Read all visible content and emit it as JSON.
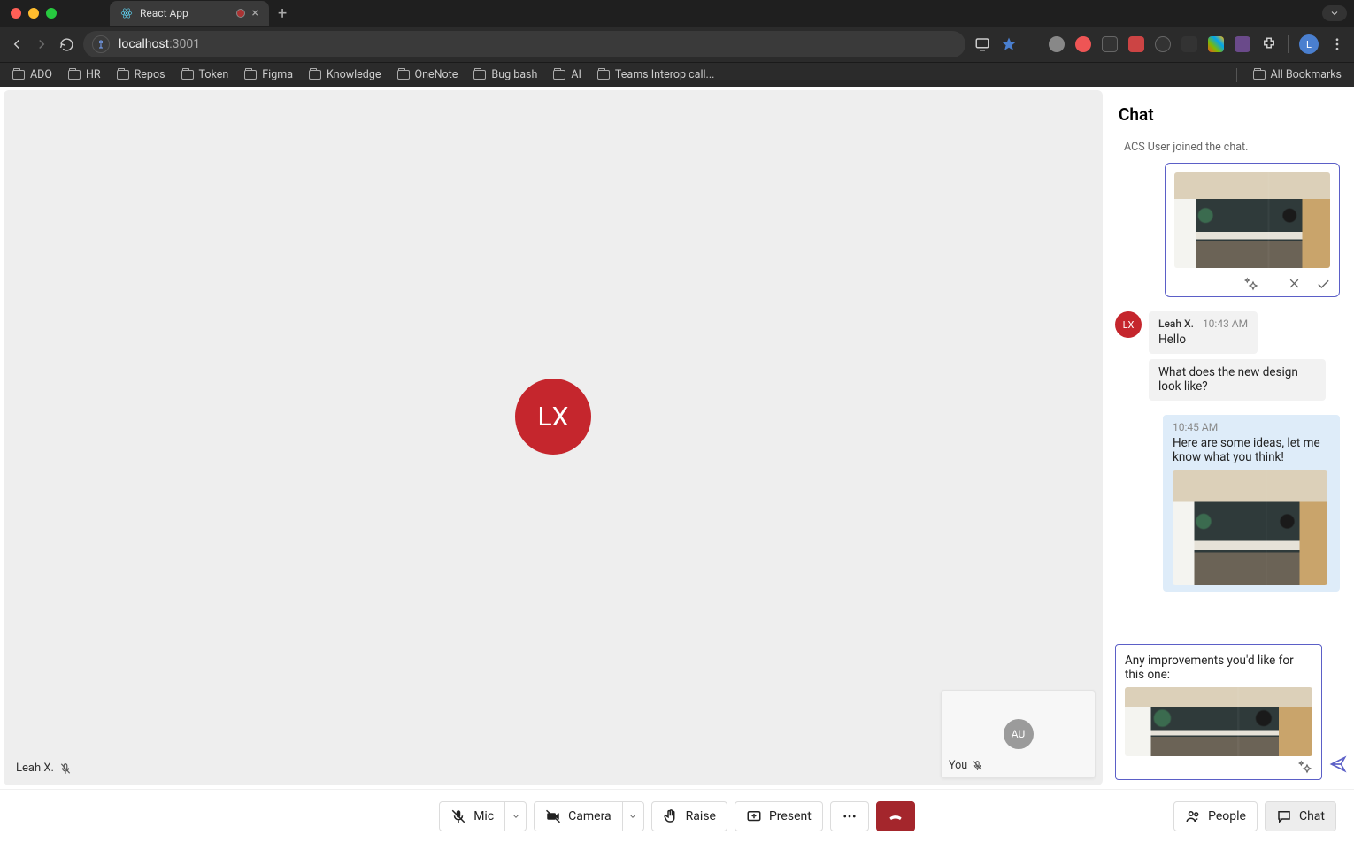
{
  "browser": {
    "tab_title": "React App",
    "url_host": "localhost",
    "url_path": ":3001",
    "bookmarks": [
      "ADO",
      "HR",
      "Repos",
      "Token",
      "Figma",
      "Knowledge",
      "OneNote",
      "Bug bash",
      "AI",
      "Teams Interop call..."
    ],
    "all_bookmarks": "All Bookmarks",
    "profile_initial": "L"
  },
  "call": {
    "main_initials": "LX",
    "main_name": "Leah X.",
    "self_initials": "AU",
    "self_label": "You"
  },
  "chat": {
    "title": "Chat",
    "system": "ACS User joined the chat.",
    "m1_author": "Leah X.",
    "m1_time": "10:43 AM",
    "m1_body": "Hello",
    "m2_body": "What does the new design look like?",
    "m3_time": "10:45 AM",
    "m3_body": "Here are some ideas, let me know what you think!",
    "compose_text": "Any improvements you'd like for this one:"
  },
  "controls": {
    "mic": "Mic",
    "camera": "Camera",
    "raise": "Raise",
    "present": "Present",
    "people": "People",
    "chat": "Chat"
  }
}
